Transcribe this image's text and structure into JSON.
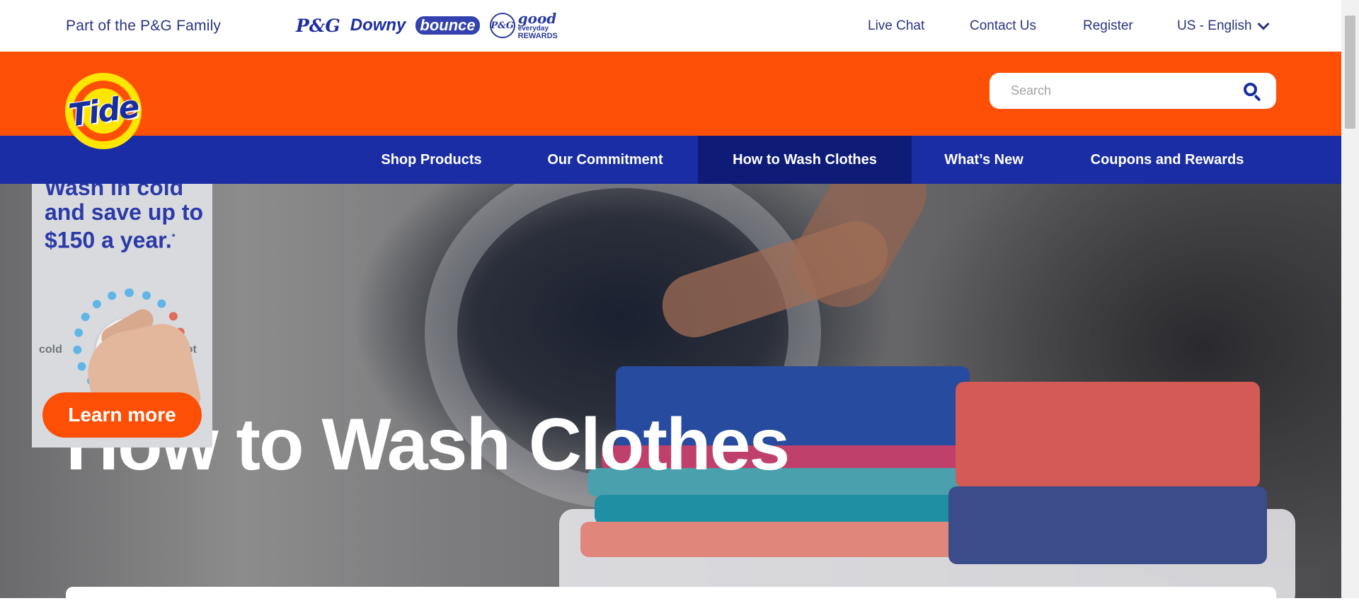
{
  "utility_bar": {
    "family_text": "Part of the P&G Family",
    "brands": {
      "pg": "P&G",
      "downy": "Downy",
      "bounce": "bounce",
      "gev_circle": "P&G",
      "gev_good": "good",
      "gev_everyday": "everyday",
      "gev_rewards": "REWARDS"
    },
    "links": {
      "live_chat": "Live Chat",
      "contact_us": "Contact Us",
      "register": "Register",
      "language": "US - English"
    }
  },
  "header": {
    "logo_text": "Tide",
    "search_placeholder": "Search"
  },
  "nav": {
    "items": [
      "Shop Products",
      "Our Commitment",
      "How to Wash Clothes",
      "What’s New",
      "Coupons and Rewards"
    ],
    "active_index": 2
  },
  "hero": {
    "title": "How to Wash Clothes"
  },
  "ad": {
    "headline": "Wash in cold and save up to $150 a year.",
    "headline_mark": "*",
    "cold_label": "cold",
    "hot_label": "hot",
    "cta": "Learn more"
  },
  "colors": {
    "orange": "#fd4f06",
    "blue": "#1a2da4",
    "active_nav": "#0e1c78",
    "yellow": "#ffe600",
    "link_text": "#2a3580"
  },
  "icons": [
    "chevron-down-icon",
    "search-icon"
  ]
}
